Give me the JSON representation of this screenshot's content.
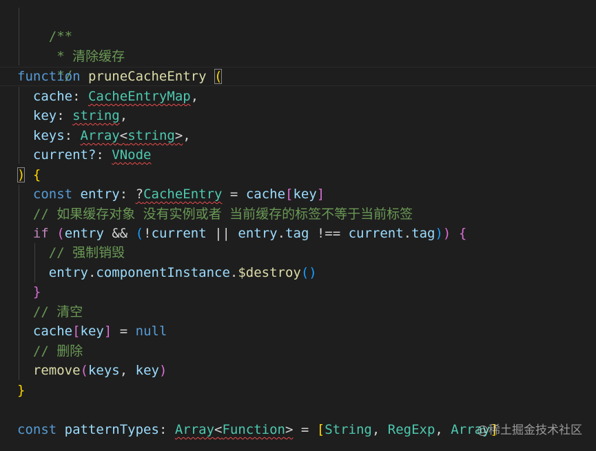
{
  "colors": {
    "background": "#1e1e1e",
    "comment": "#6a9955",
    "keyword": "#569cd6",
    "control": "#c586c0",
    "function": "#dcdcaa",
    "variable": "#9cdcfe",
    "type": "#4ec9b0",
    "bracket_level1": "#ffd700",
    "bracket_level2": "#da70d6",
    "bracket_level3": "#179fff",
    "error_squiggle": "#f14c4c"
  },
  "code": {
    "l1": {
      "comment": "/**"
    },
    "l2": {
      "comment": " * 清除缓存"
    },
    "l3": {
      "comment": " */"
    },
    "l4": {
      "kw": "function",
      "name": "pruneCacheEntry",
      "open": "("
    },
    "l5": {
      "name": "cache",
      "colon": ": ",
      "type": "CacheEntryMap",
      "comma": ","
    },
    "l6": {
      "name": "key",
      "colon": ": ",
      "type": "string",
      "comma": ","
    },
    "l7": {
      "name": "keys",
      "colon": ": ",
      "type": "Array",
      "lt": "<",
      "type2": "string",
      "gt": ">",
      "comma": ","
    },
    "l8": {
      "name": "current?",
      "colon": ": ",
      "type": "VNode"
    },
    "l9": {
      "close": ")",
      "brace": "{"
    },
    "l10": {
      "kw": "const",
      "name": "entry",
      "colon": ": ",
      "q": "?",
      "type": "CacheEntry",
      "eq": " = ",
      "obj": "cache",
      "lb": "[",
      "idx": "key",
      "rb": "]"
    },
    "l11": {
      "comment": "// 如果缓存对象 没有实例或者 当前缓存的标签不等于当前标签"
    },
    "l12": {
      "kw": "if",
      "p1": "(",
      "a": "entry",
      "and": " && ",
      "p2": "(",
      "not": "!",
      "b": "current",
      "or": " || ",
      "c": "entry",
      "dot1": ".",
      "d": "tag",
      "neq": " !== ",
      "e": "current",
      "dot2": ".",
      "f": "tag",
      "p3": ")",
      "p4": ")",
      "brace": "{"
    },
    "l13": {
      "comment": "// 强制销毁"
    },
    "l14": {
      "obj": "entry",
      "dot1": ".",
      "prop": "componentInstance",
      "dot2": ".",
      "fn": "$destroy",
      "parens": "()"
    },
    "l15": {
      "brace": "}"
    },
    "l16": {
      "comment": "// 清空"
    },
    "l17": {
      "obj": "cache",
      "lb": "[",
      "idx": "key",
      "rb": "]",
      "eq": " = ",
      "val": "null"
    },
    "l18": {
      "comment": "// 删除"
    },
    "l19": {
      "fn": "remove",
      "p1": "(",
      "a": "keys",
      "comma": ", ",
      "b": "key",
      "p2": ")"
    },
    "l20": {
      "brace": "}"
    },
    "l22": {
      "kw": "const",
      "name": "patternTypes",
      "colon": ": ",
      "type": "Array",
      "lt": "<",
      "type2": "Function",
      "gt": ">",
      "eq": " = ",
      "lb": "[",
      "t1": "String",
      "c1": ", ",
      "t2": "RegExp",
      "c2": ", ",
      "t3": "Array",
      "rb": "]"
    }
  },
  "watermark": "@稀土掘金技术社区"
}
